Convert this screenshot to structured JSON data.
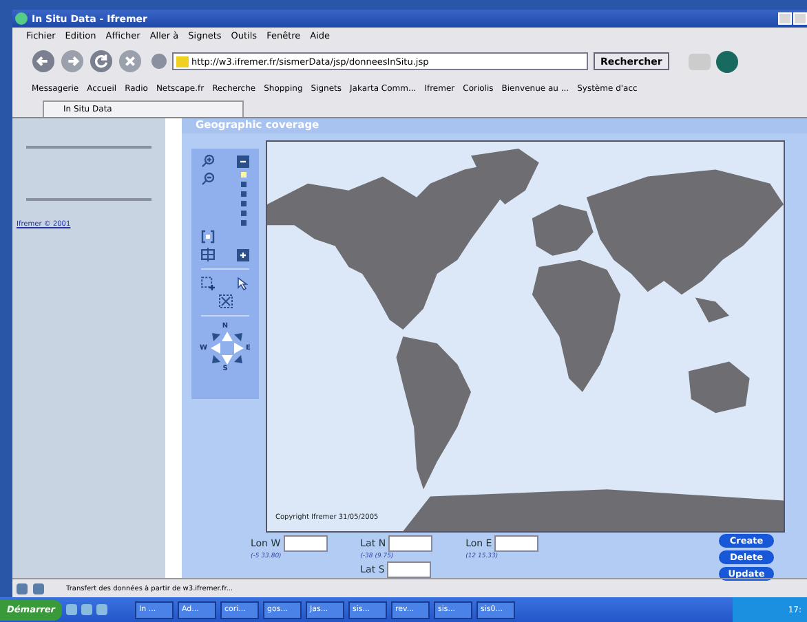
{
  "window": {
    "title": "In Situ Data - Ifremer"
  },
  "menu": [
    "Fichier",
    "Edition",
    "Afficher",
    "Aller à",
    "Signets",
    "Outils",
    "Fenêtre",
    "Aide"
  ],
  "address": {
    "value": "http://w3.ifremer.fr/sismerData/jsp/donneesInSitu.jsp"
  },
  "search_button": "Rechercher",
  "bookmarks": [
    "Messagerie",
    "Accueil",
    "Radio",
    "Netscape.fr",
    "Recherche",
    "Shopping",
    "Signets",
    "Jakarta Comm...",
    "Ifremer",
    "Coriolis",
    "Bienvenue au ...",
    "Système d'acc"
  ],
  "tabs": [
    {
      "label": "In Situ Data",
      "selected": true
    }
  ],
  "sidebar": {
    "link": "Ifremer © 2001"
  },
  "panel": {
    "title": "Geographic coverage",
    "zoom_steps": [
      {
        "selected": true
      },
      {
        "selected": false
      },
      {
        "selected": false
      },
      {
        "selected": false
      },
      {
        "selected": false
      },
      {
        "selected": false
      }
    ],
    "compass": {
      "n": "N",
      "w": "W",
      "e": "E",
      "s": "S"
    },
    "map_copyright": "Copyright Ifremer 31/05/2005"
  },
  "form": {
    "lon_w": {
      "label": "Lon W",
      "hint": "(-5 33.80)"
    },
    "lat_n": {
      "label": "Lat N",
      "hint": "(-38 (9.75)"
    },
    "lat_s": {
      "label": "Lat S"
    },
    "lon_e": {
      "label": "Lon E",
      "hint": "(12 15.33)"
    },
    "buttons": [
      "Create",
      "Delete",
      "Update"
    ]
  },
  "status_bar": "Transfert des données à partir de w3.ifremer.fr...",
  "taskbar": {
    "start": "Démarrer",
    "tasks": [
      "In ...",
      "Ad...",
      "cori...",
      "gos...",
      "Jas...",
      "sis...",
      "rev...",
      "sis...",
      "sis0..."
    ],
    "clock": "17:"
  }
}
